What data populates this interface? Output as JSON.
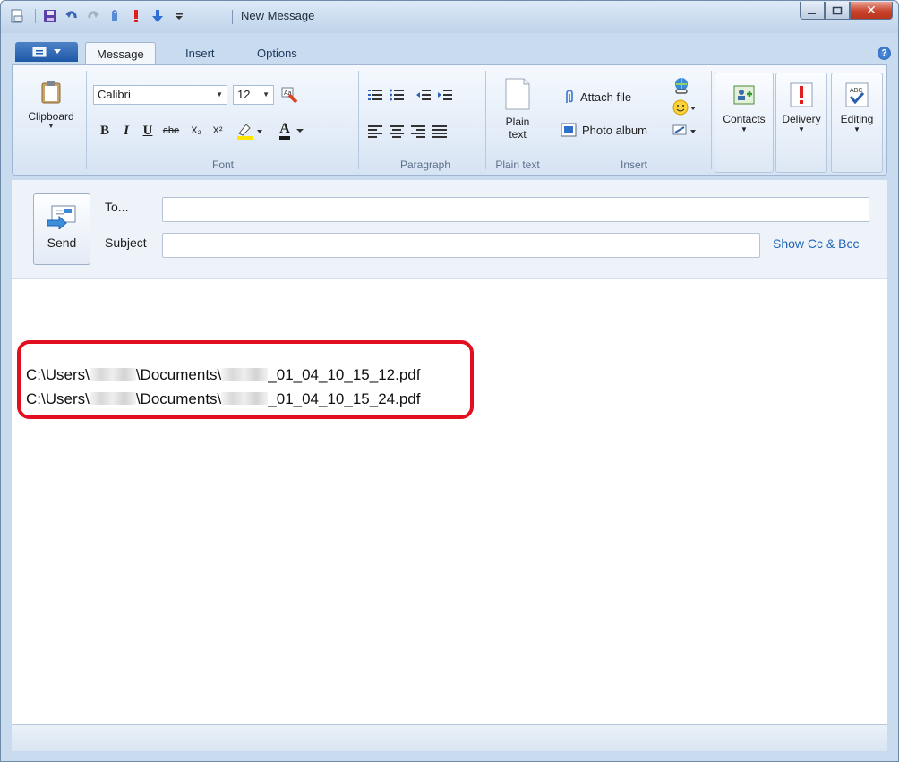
{
  "window": {
    "title": "New Message"
  },
  "tabs": [
    "Message",
    "Insert",
    "Options"
  ],
  "ribbon": {
    "clipboard": {
      "label": "Clipboard"
    },
    "font": {
      "family": "Calibri",
      "size": "12",
      "group_label": "Font",
      "bold": "B",
      "italic": "I",
      "underline": "U",
      "strike": "abe",
      "subscript": "X₂",
      "superscript": "X²",
      "font_color_letter": "A"
    },
    "paragraph": {
      "group_label": "Paragraph"
    },
    "plain_text": {
      "button_label_1": "Plain",
      "button_label_2": "text",
      "group_label": "Plain text"
    },
    "insert": {
      "attach_file": "Attach file",
      "photo_album": "Photo album",
      "group_label": "Insert"
    },
    "contacts": "Contacts",
    "delivery": "Delivery",
    "editing": "Editing",
    "spelling_glyph": "ABC"
  },
  "compose": {
    "send_label": "Send",
    "to_label": "To...",
    "subject_label": "Subject",
    "show_cc_bcc": "Show Cc & Bcc",
    "to_value": "",
    "subject_value": ""
  },
  "body": {
    "attachments": [
      {
        "prefix": "C:\\Users\\",
        "middle": "\\Documents\\",
        "suffix": "_01_04_10_15_12.pdf"
      },
      {
        "prefix": "C:\\Users\\",
        "middle": "\\Documents\\",
        "suffix": "_01_04_10_15_24.pdf"
      }
    ]
  },
  "colors": {
    "highlight_box": "#e10f1f",
    "link": "#1f64b5",
    "close_button": "#c9442b"
  }
}
